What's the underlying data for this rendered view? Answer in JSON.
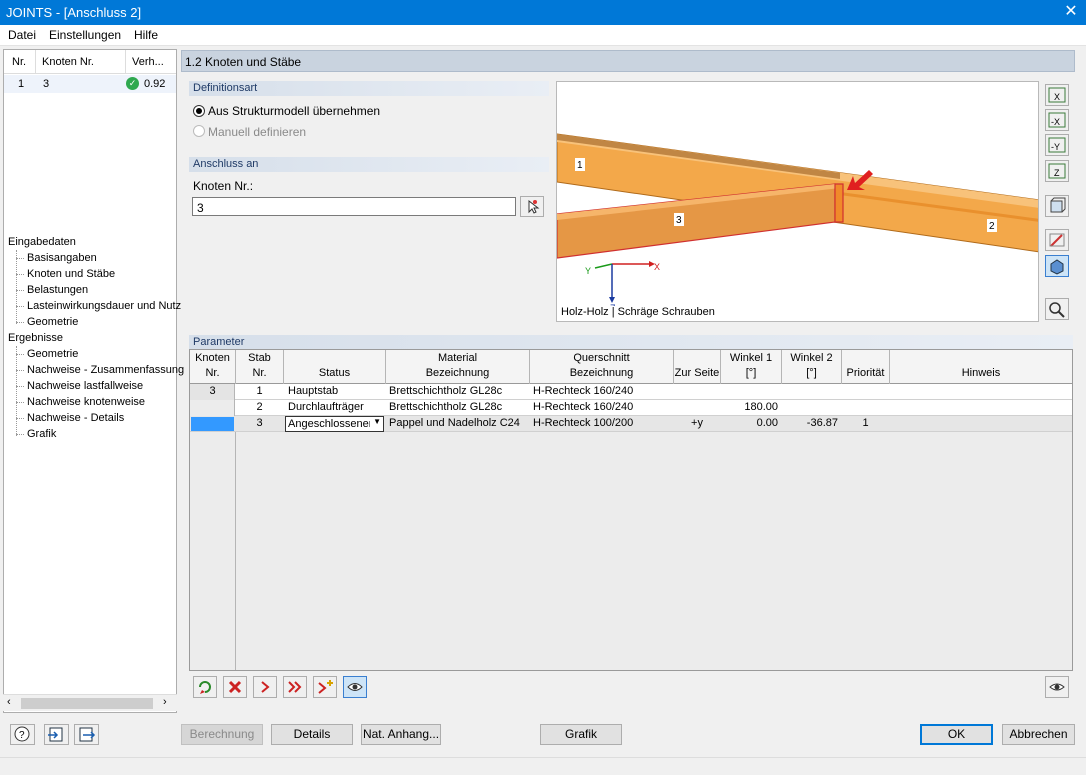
{
  "window": {
    "title": "JOINTS - [Anschluss 2]"
  },
  "menu": {
    "items": [
      "Datei",
      "Einstellungen",
      "Hilfe"
    ]
  },
  "left_table": {
    "headers": [
      "Nr.",
      "Knoten Nr.",
      "Verh..."
    ],
    "row": {
      "nr": "1",
      "knoten": "3",
      "verh": "0.92"
    }
  },
  "tree": {
    "input_root": "Eingabedaten",
    "input_items": [
      "Basisangaben",
      "Knoten und Stäbe",
      "Belastungen",
      "Lasteinwirkungsdauer und Nutz",
      "Geometrie"
    ],
    "results_root": "Ergebnisse",
    "results_items": [
      "Geometrie",
      "Nachweise - Zusammenfassung",
      "Nachweise lastfallweise",
      "Nachweise knotenweise",
      "Nachweise - Details",
      "Grafik"
    ]
  },
  "section": {
    "title": "1.2 Knoten und Stäbe"
  },
  "definitionsart": {
    "header": "Definitionsart",
    "option1": "Aus Strukturmodell übernehmen",
    "option2": "Manuell definieren"
  },
  "anschluss": {
    "header": "Anschluss an",
    "label": "Knoten Nr.:",
    "value": "3"
  },
  "view3d": {
    "member_labels": [
      "1",
      "2",
      "3"
    ],
    "axis_labels": {
      "x": "X",
      "y": "Y",
      "z": "Z"
    },
    "caption": "Holz-Holz | Schräge Schrauben",
    "colors": {
      "beam": "#f0a040",
      "beam_edge": "#b06a1a",
      "highlight": "#e02020"
    }
  },
  "toolbar_icons": [
    "view-x-icon",
    "view-minus-x-icon",
    "view-minus-y-icon",
    "view-z-icon",
    "iso-view-icon",
    "select-icon",
    "render-icon",
    "zoom-settings-icon"
  ],
  "parameter": {
    "header": "Parameter",
    "columns": [
      {
        "top": "Knoten",
        "bottom": "Nr."
      },
      {
        "top": "Stab",
        "bottom": "Nr."
      },
      {
        "top": "",
        "bottom": "Status"
      },
      {
        "top": "Material",
        "bottom": "Bezeichnung"
      },
      {
        "top": "Querschnitt",
        "bottom": "Bezeichnung"
      },
      {
        "top": "",
        "bottom": "Zur Seite"
      },
      {
        "top": "Winkel 1",
        "bottom": "[°]"
      },
      {
        "top": "Winkel 2",
        "bottom": "[°]"
      },
      {
        "top": "",
        "bottom": "Priorität"
      },
      {
        "top": "",
        "bottom": "Hinweis"
      }
    ],
    "knoten_nr": "3",
    "rows": [
      {
        "stab": "1",
        "status": "Hauptstab",
        "material": "Brettschichtholz GL28c",
        "querschnitt": "H-Rechteck 160/240",
        "seite": "",
        "w1": "",
        "w2": "",
        "prio": "",
        "hinweis": ""
      },
      {
        "stab": "2",
        "status": "Durchlaufträger",
        "material": "Brettschichtholz GL28c",
        "querschnitt": "H-Rechteck 160/240",
        "seite": "",
        "w1": "180.00",
        "w2": "",
        "prio": "",
        "hinweis": ""
      },
      {
        "stab": "3",
        "status": "Angeschlossener",
        "material": "Pappel und Nadelholz C24",
        "querschnitt": "H-Rechteck 100/200",
        "seite": "+y",
        "w1": "0.00",
        "w2": "-36.87",
        "prio": "1",
        "hinweis": ""
      }
    ]
  },
  "bottom_toolbar": [
    "reset-icon",
    "delete-icon",
    "next-icon",
    "last-icon",
    "add-icon",
    "view-icon"
  ],
  "buttons": {
    "berechnung": "Berechnung",
    "details": "Details",
    "nat_anhang": "Nat. Anhang...",
    "grafik": "Grafik",
    "ok": "OK",
    "abbrechen": "Abbrechen"
  }
}
